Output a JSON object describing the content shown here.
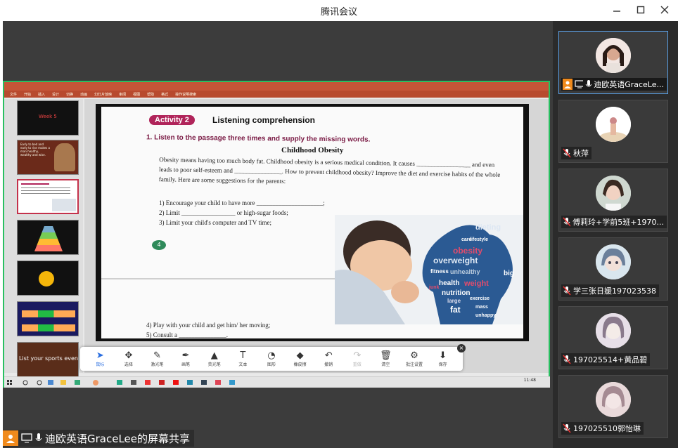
{
  "window": {
    "title": "腾讯会议"
  },
  "share_banner": {
    "text": "迪欧英语GraceLee的屏幕共享"
  },
  "participants": [
    {
      "name": "迪欧英语GraceLe..."
    },
    {
      "name": "秋萍"
    },
    {
      "name": "傅莉玲+学前5班+1970..."
    },
    {
      "name": "学三张日媛197023538"
    },
    {
      "name": "197025514+黄品碧"
    },
    {
      "name": "197025510郭怡琳"
    }
  ],
  "ppt": {
    "tabs": [
      "文件",
      "开始",
      "插入",
      "设计",
      "切换",
      "动画",
      "幻灯片放映",
      "审阅",
      "视图",
      "帮助",
      "格式",
      "操作说明搜索"
    ],
    "thumb_numbers": [
      "52",
      "53",
      "54",
      "55",
      "56",
      "57",
      "58"
    ],
    "thumb_texts": [
      "Week 5",
      "Early to bed and early to rise makes a man healthy, wealthy and wise.",
      "",
      "",
      "",
      "",
      "List your sports event"
    ]
  },
  "slide": {
    "activity_badge": "Activity 2",
    "activity_title": "Listening comprehension",
    "question": "1.  Listen to the passage three times and supply the missing words.",
    "story_title": "Childhood Obesity",
    "paragraph": "Obesity means having too much body fat. Childhood obesity is a serious medical condition. It causes _________________ and even leads to poor self-esteem and _______________. How to prevent childhood obesity? Improve the diet and exercise habits of the whole family. Here are some suggestions for the parents:",
    "items": [
      "1)  Encourage your child to have more _____________________;",
      "2)  Limit _________________ or high-sugar foods;",
      "3)  Limit your child's computer and TV time;"
    ],
    "circle_label": "4",
    "items2": [
      "4)  Play with your child and get him/ her moving;",
      "5)  Consult a _______________."
    ],
    "wordcloud_words": [
      "obesity",
      "overweight",
      "dieting",
      "health",
      "weight",
      "fitness",
      "unhealthy",
      "nutrition",
      "large",
      "fat",
      "exercise",
      "care",
      "lifestyle",
      "big",
      "mass",
      "junk",
      "unhappy"
    ]
  },
  "annotation_toolbar": {
    "tools": [
      {
        "label": "鼠标",
        "icon": "cursor-icon"
      },
      {
        "label": "选择",
        "icon": "move-icon"
      },
      {
        "label": "激光笔",
        "icon": "laser-icon"
      },
      {
        "label": "画笔",
        "icon": "pen-icon"
      },
      {
        "label": "荧光笔",
        "icon": "highlighter-icon"
      },
      {
        "label": "文本",
        "icon": "text-icon"
      },
      {
        "label": "图形",
        "icon": "shape-icon"
      },
      {
        "label": "橡皮擦",
        "icon": "eraser-icon"
      },
      {
        "label": "撤销",
        "icon": "undo-icon"
      },
      {
        "label": "重做",
        "icon": "redo-icon"
      },
      {
        "label": "清空",
        "icon": "trash-icon"
      },
      {
        "label": "批注设置",
        "icon": "settings-icon"
      },
      {
        "label": "保存",
        "icon": "download-icon"
      }
    ]
  },
  "taskbar": {
    "time": "11:48"
  }
}
